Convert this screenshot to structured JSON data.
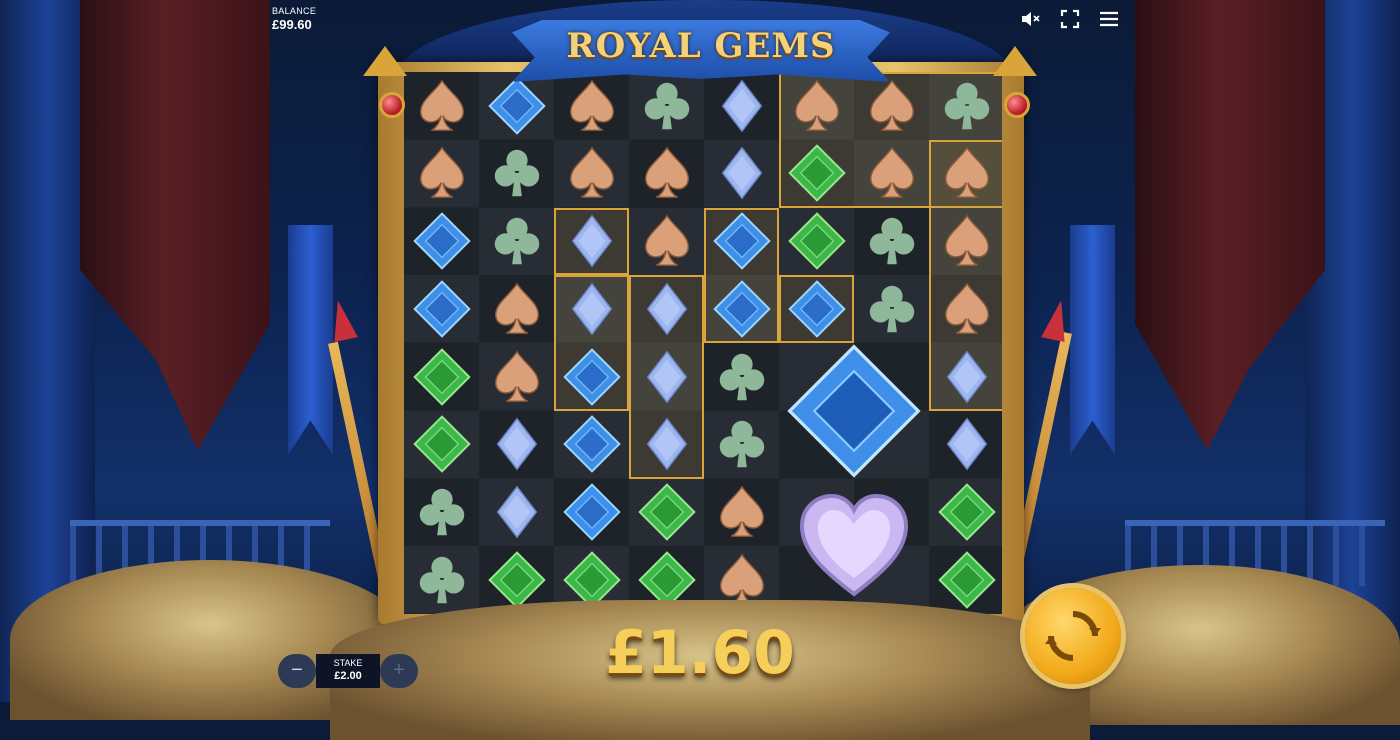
{
  "balance": {
    "label": "BALANCE",
    "value": "£99.60"
  },
  "title": "ROYAL GEMS",
  "win_amount": "£1.60",
  "stake": {
    "label": "STAKE",
    "value": "£2.00",
    "minus": "−",
    "plus": "+"
  },
  "toolbar": {
    "sound_icon": "sound-muted-icon",
    "fullscreen_icon": "fullscreen-icon",
    "menu_icon": "menu-icon"
  },
  "spin_icon": "spin-icon",
  "colors": {
    "spade": "#d9a07a",
    "club": "#8fb79a",
    "diamond_light": "#9eb6f0",
    "blue_gem": "#3f8ee8",
    "green_gem": "#3cb84a",
    "heart_gem": "#cbb8f2",
    "gold": "#f5cf5a"
  },
  "grid": {
    "cols": 8,
    "rows": 8,
    "symbols": [
      [
        "spade",
        "blue",
        "spade",
        "club",
        "diamond",
        "spade",
        "spade",
        "club"
      ],
      [
        "spade",
        "club",
        "spade",
        "spade",
        "diamond",
        "green",
        "spade",
        "spade"
      ],
      [
        "blue",
        "club",
        "diamond",
        "spade",
        "blue",
        "green",
        "club",
        "spade"
      ],
      [
        "blue",
        "spade",
        "diamond",
        "diamond",
        "blue",
        "blue",
        "club",
        "spade"
      ],
      [
        "green",
        "spade",
        "blue",
        "diamond",
        "club",
        "bigblue",
        "bigblue",
        "diamond"
      ],
      [
        "green",
        "diamond",
        "blue",
        "diamond",
        "club",
        "bigblue",
        "bigblue",
        "diamond"
      ],
      [
        "club",
        "diamond",
        "blue",
        "green",
        "spade",
        "heart",
        "heart",
        "green"
      ],
      [
        "club",
        "green",
        "green",
        "green",
        "spade",
        "heart",
        "heart",
        "green"
      ]
    ]
  }
}
